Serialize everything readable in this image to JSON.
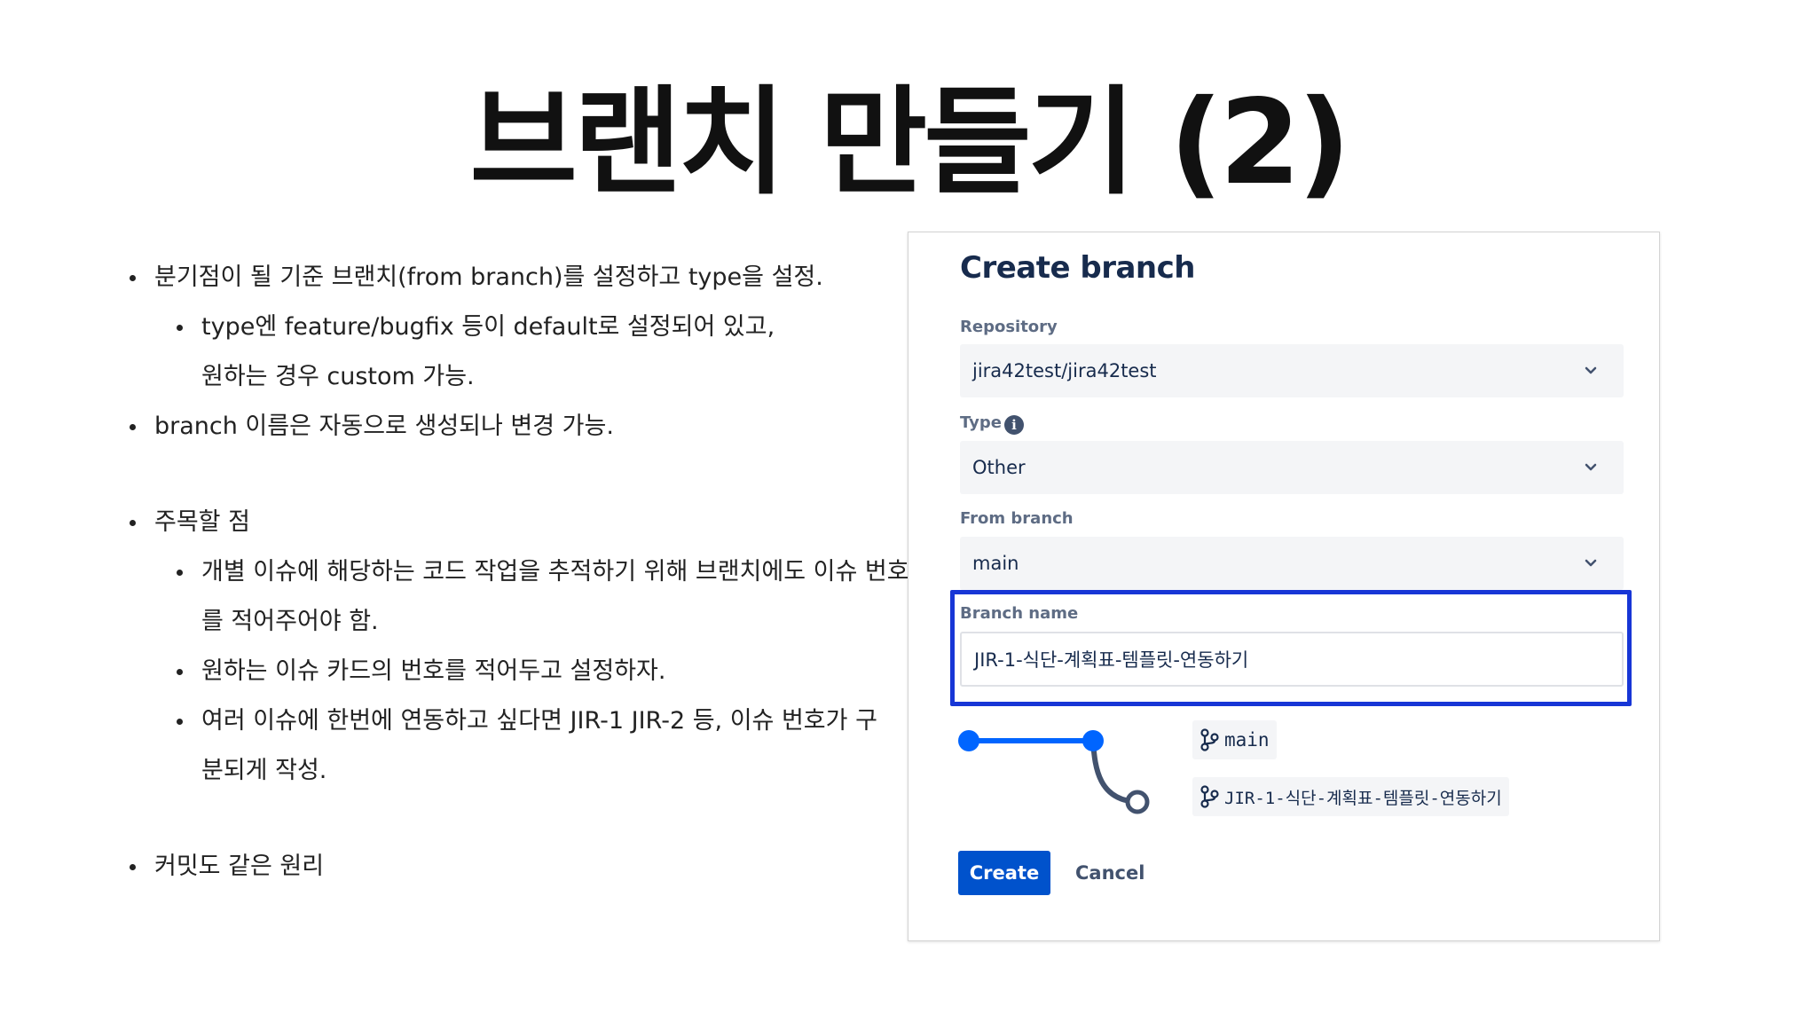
{
  "slide": {
    "title": "브랜치 만들기 (2)"
  },
  "notes": {
    "b1": "분기점이 될 기준 브랜치(from branch)를 설정하고 type을 설정.",
    "b1_sub1_line1": "type엔 feature/bugfix 등이 default로 설정되어 있고,",
    "b1_sub1_line2": "원하는 경우 custom 가능.",
    "b2": "branch 이름은 자동으로 생성되나 변경 가능.",
    "b3": "주목할 점",
    "b3_sub1_line1": "개별 이슈에 해당하는 코드 작업을 추적하기 위해 브랜치에도 이슈 번호",
    "b3_sub1_line2": "를 적어주어야 함.",
    "b3_sub2": "원하는 이슈 카드의 번호를 적어두고 설정하자.",
    "b3_sub3_line1": "여러 이슈에 한번에 연동하고 싶다면 JIR-1 JIR-2 등, 이슈 번호가 구",
    "b3_sub3_line2": "분되게 작성.",
    "b4": "커밋도 같은 원리"
  },
  "dialog": {
    "title": "Create branch",
    "repository_label": "Repository",
    "repository_value": "jira42test/jira42test",
    "type_label": "Type",
    "type_value": "Other",
    "from_branch_label": "From branch",
    "from_branch_value": "main",
    "branch_name_label": "Branch name",
    "branch_name_value": "JIR-1-식단-계획표-템플릿-연동하기",
    "graph_source": "main",
    "graph_target": "JIR-1-식단-계획표-템플릿-연동하기",
    "create_label": "Create",
    "cancel_label": "Cancel"
  },
  "colors": {
    "primary": "#0052cc",
    "highlight_border": "#1736d6",
    "graph_line": "#0065ff"
  }
}
